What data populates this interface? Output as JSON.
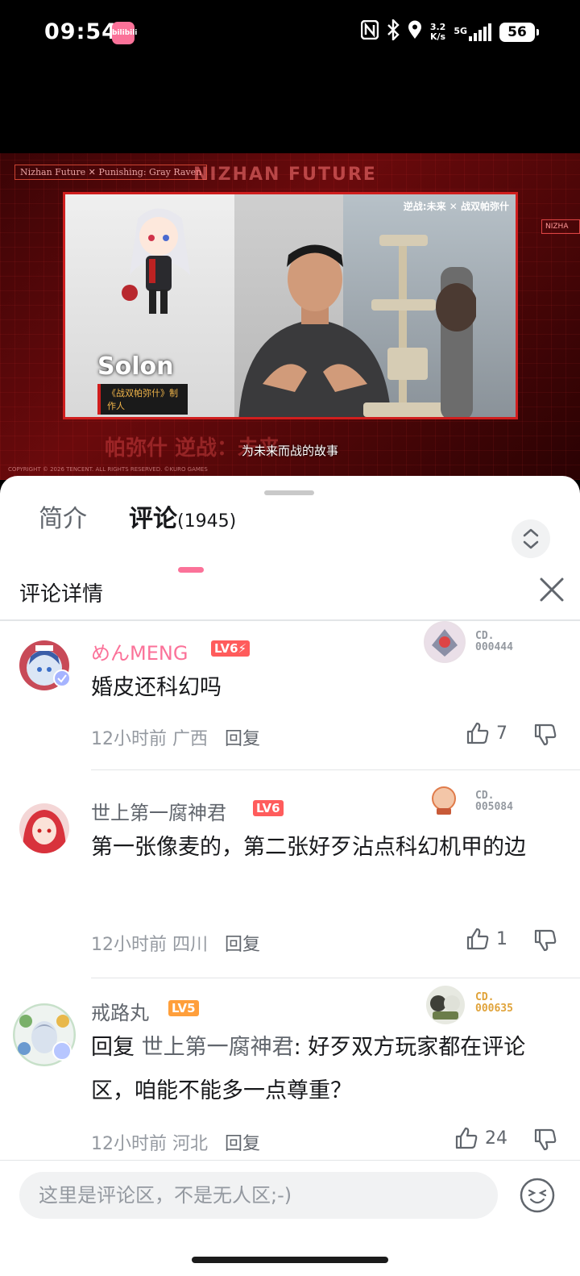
{
  "status_bar": {
    "time": "09:54",
    "app_badge": "bilibili",
    "net_speed_value": "3.2",
    "net_speed_unit": "K/s",
    "net_type": "5G",
    "battery": "56"
  },
  "video": {
    "top_left_tag": "Nizhan Future ✕ Punishing: Gray Raven",
    "headline": "NIZHAN FUTURE",
    "logo": "逆战:未来 ✕ 战双帕弥什",
    "person_name": "Solon",
    "person_role": "《战双帕弥什》制作人",
    "subtitle": "为未来而战的故事",
    "copyright": "COPYRIGHT © 2026 TENCENT. ALL RIGHTS RESERVED.   ©KURO GAMES",
    "bottom_text": "帕弥什    逆战：未来",
    "right_tag": "NIZHA"
  },
  "tabs": {
    "intro_label": "简介",
    "comments_label": "评论",
    "comments_count": "(1945)"
  },
  "detail": {
    "title": "评论详情"
  },
  "comments": [
    {
      "username": "めんMENG",
      "level": "LV6⚡",
      "medal_line1": "CD.",
      "medal_line2": "000444",
      "text": "婚皮还科幻吗",
      "time": "12小时前",
      "location": "广西",
      "reply_label": "回复",
      "likes": "7"
    },
    {
      "username": "世上第一腐神君",
      "level": "LV6",
      "medal_line1": "CD.",
      "medal_line2": "005084",
      "text": "第一张像麦的，第二张好歹沾点科幻机甲的边",
      "time": "12小时前",
      "location": "四川",
      "reply_label": "回复",
      "likes": "1"
    },
    {
      "username": "戒路丸",
      "level": "LV5",
      "medal_line1": "CD.",
      "medal_line2": "000635",
      "reply_prefix": "回复 ",
      "reply_target": "世上第一腐神君",
      "text": ": 好歹双方玩家都在评论区，咱能不能多一点尊重？",
      "time": "12小时前",
      "location": "河北",
      "reply_label": "回复",
      "likes": "24"
    }
  ],
  "input": {
    "placeholder": "这里是评论区，不是无人区;-)"
  },
  "colors": {
    "accent": "#fb7299",
    "level6": "#ff5c5c",
    "level5": "#ff9f3b",
    "video_red": "#d01e1e"
  }
}
